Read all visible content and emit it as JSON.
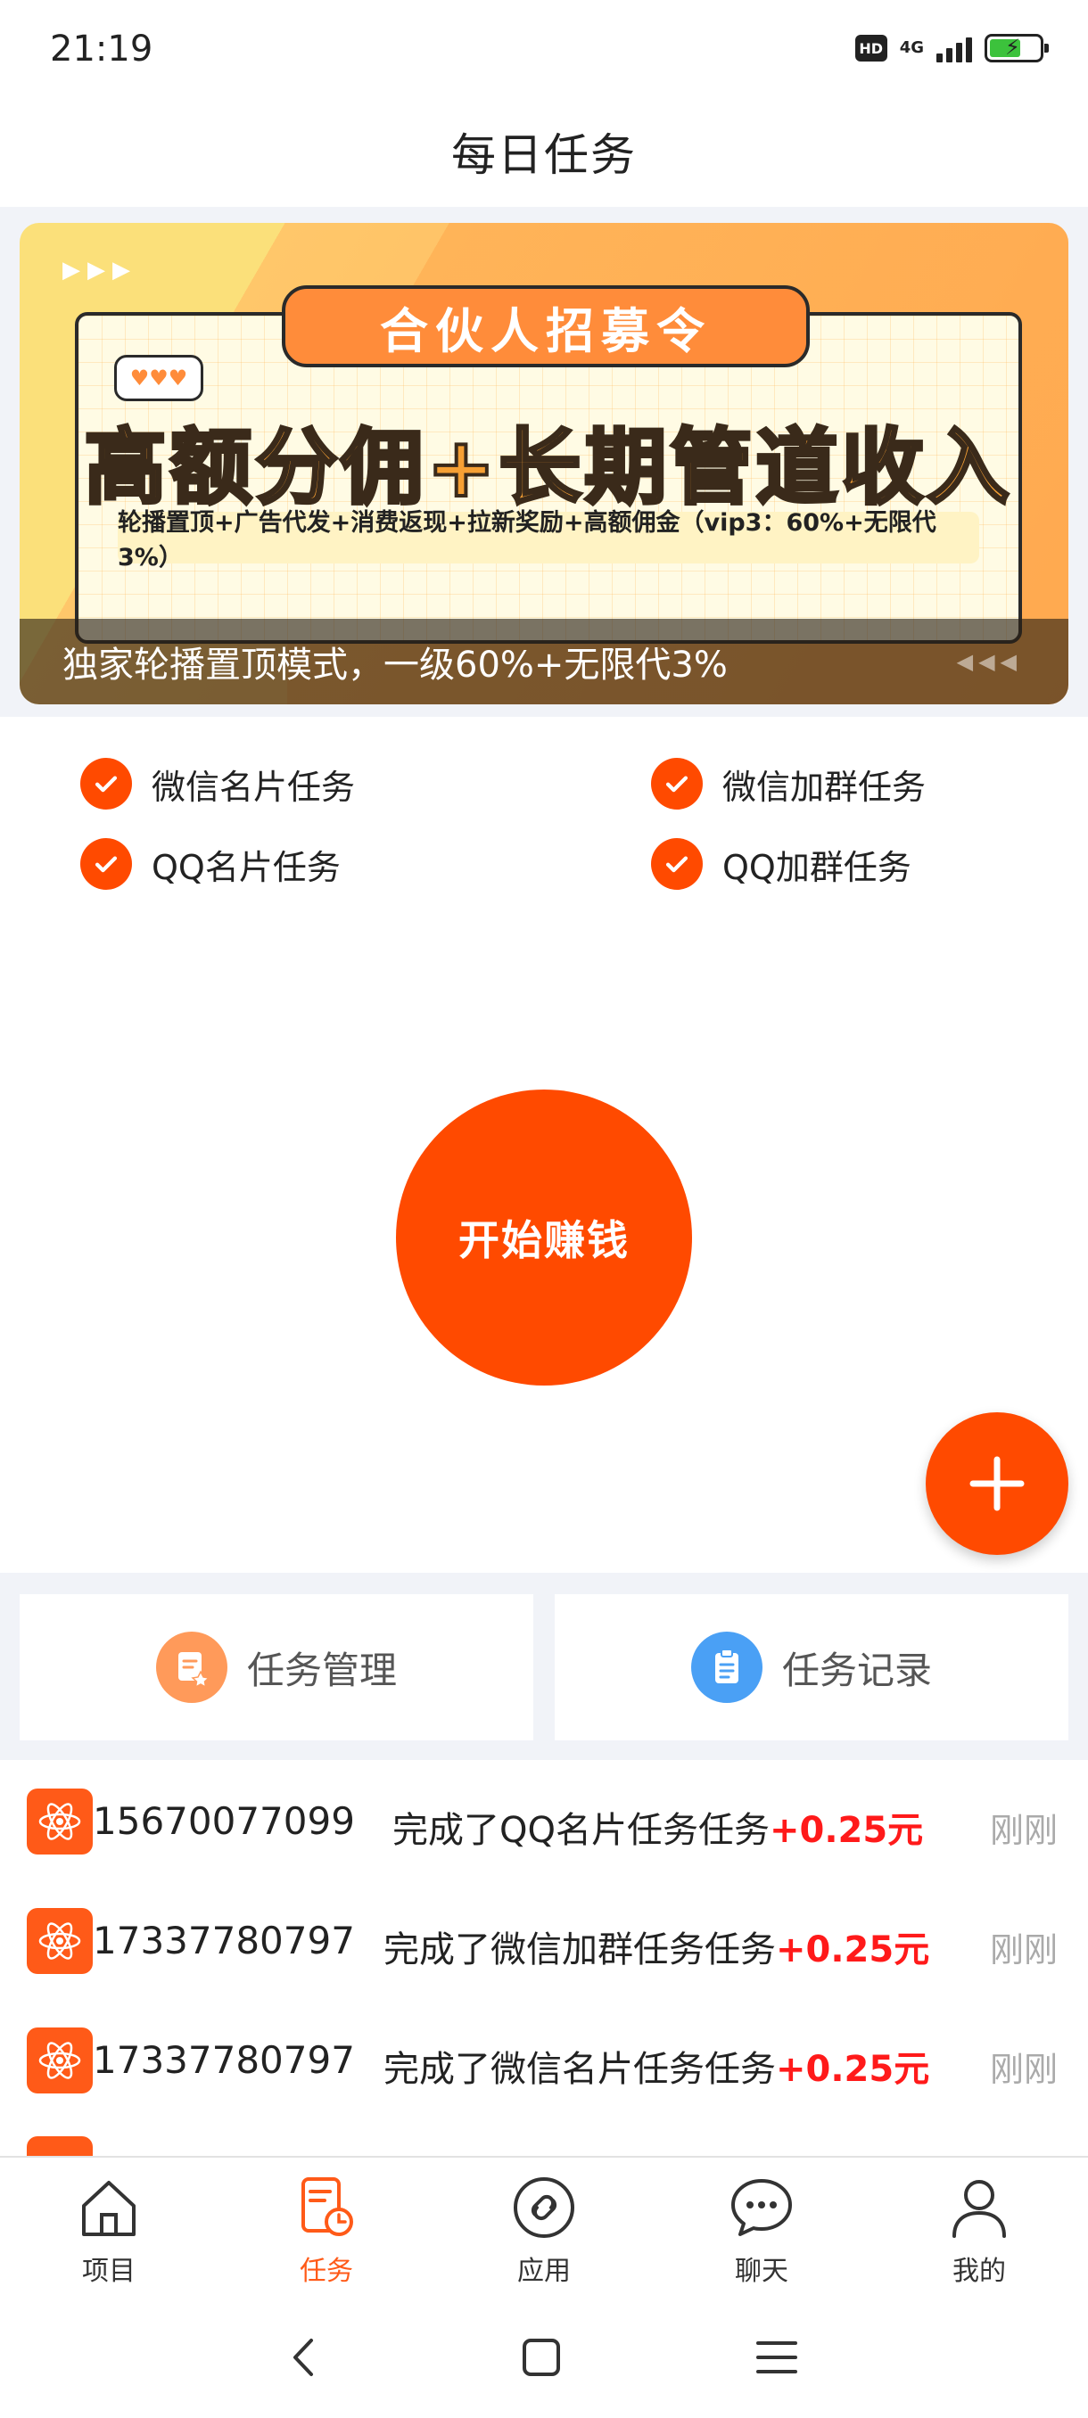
{
  "status_bar": {
    "time": "21:19",
    "hd_label": "HD",
    "network": "4G"
  },
  "header": {
    "title": "每日任务"
  },
  "banner": {
    "header_text": "合伙人招募令",
    "headline": "高额分佣+长期管道收入",
    "subline": "轮播置顶+广告代发+消费返现+拉新奖励+高额佣金（vip3：60%+无限代3%）",
    "caption": "独家轮播置顶模式，一级60%+无限代3%"
  },
  "features": [
    {
      "label": "微信名片任务"
    },
    {
      "label": "微信加群任务"
    },
    {
      "label": "QQ名片任务"
    },
    {
      "label": "QQ加群任务"
    }
  ],
  "start_button": {
    "label": "开始赚钱"
  },
  "manage": {
    "task_management": "任务管理",
    "task_records": "任务记录"
  },
  "feed": [
    {
      "phone": "15670077099",
      "action": "完成了QQ名片任务任务",
      "amount": "+0.25元",
      "time": "刚刚"
    },
    {
      "phone": "17337780797",
      "action": "完成了微信加群任务任务",
      "amount": "+0.25元",
      "time": "刚刚"
    },
    {
      "phone": "17337780797",
      "action": "完成了微信名片任务任务",
      "amount": "+0.25元",
      "time": "刚刚"
    }
  ],
  "bottom_nav": [
    {
      "label": "项目",
      "icon": "home-icon",
      "active": false
    },
    {
      "label": "任务",
      "icon": "task-icon",
      "active": true
    },
    {
      "label": "应用",
      "icon": "apps-icon",
      "active": false
    },
    {
      "label": "聊天",
      "icon": "chat-icon",
      "active": false
    },
    {
      "label": "我的",
      "icon": "profile-icon",
      "active": false
    }
  ],
  "colors": {
    "accent": "#ff4a00",
    "amount": "#ff1a1a",
    "active_nav": "#ff5a18"
  }
}
